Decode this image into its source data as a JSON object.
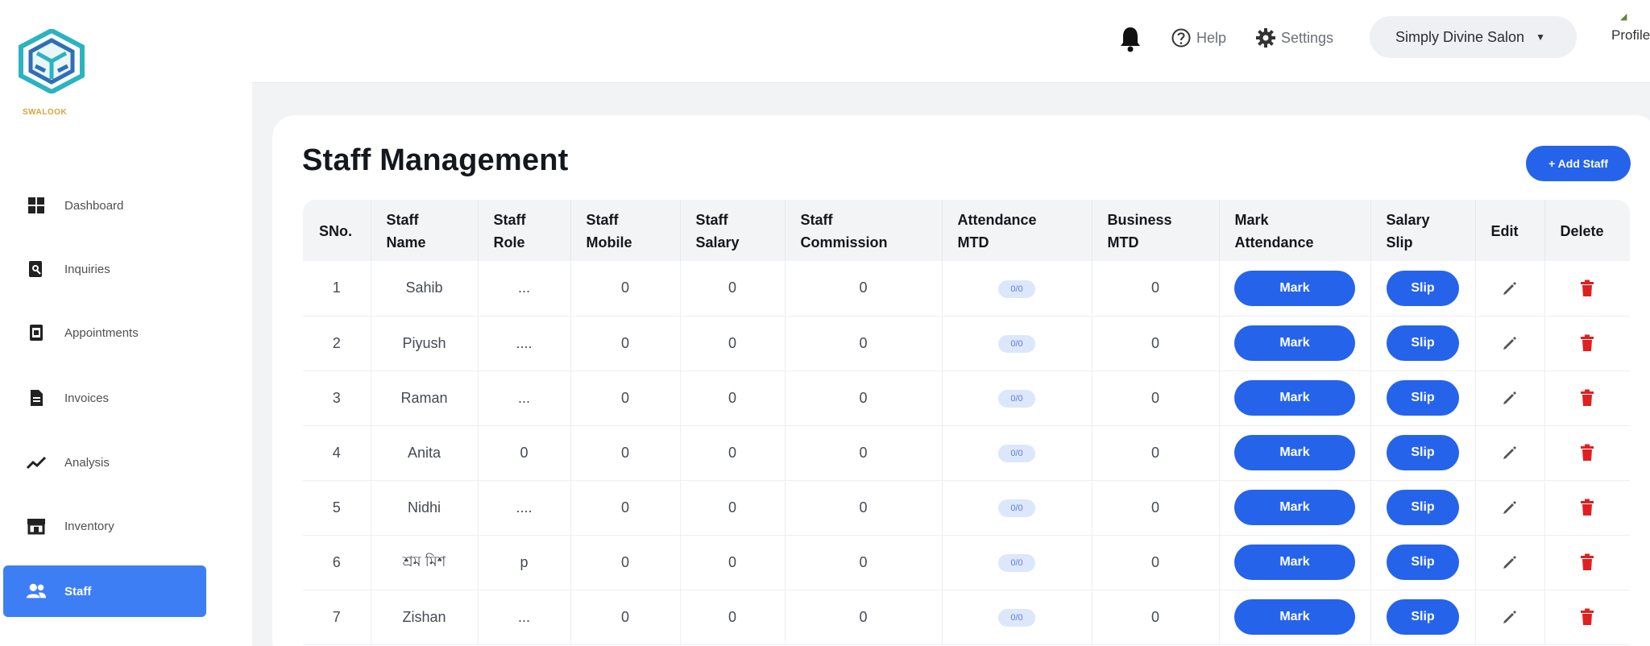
{
  "brand": {
    "name": "SWALOOK"
  },
  "sidebar": {
    "items": [
      {
        "label": "Dashboard",
        "icon": "dashboard-icon",
        "active": false
      },
      {
        "label": "Inquiries",
        "icon": "inquiries-icon",
        "active": false
      },
      {
        "label": "Appointments",
        "icon": "appointments-icon",
        "active": false
      },
      {
        "label": "Invoices",
        "icon": "invoices-icon",
        "active": false
      },
      {
        "label": "Analysis",
        "icon": "analysis-icon",
        "active": false
      },
      {
        "label": "Inventory",
        "icon": "inventory-icon",
        "active": false
      },
      {
        "label": "Staff",
        "icon": "staff-icon",
        "active": true
      }
    ]
  },
  "topbar": {
    "help_label": "Help",
    "settings_label": "Settings",
    "salon_label": "Simply Divine Salon",
    "profile_label": "Profile"
  },
  "page": {
    "title": "Staff Management",
    "add_button": "+ Add Staff"
  },
  "table": {
    "headers": [
      [
        "SNo.",
        ""
      ],
      [
        "Staff",
        "Name"
      ],
      [
        "Staff",
        "Role"
      ],
      [
        "Staff",
        "Mobile"
      ],
      [
        "Staff",
        "Salary"
      ],
      [
        "Staff",
        "Commission"
      ],
      [
        "Attendance",
        "MTD"
      ],
      [
        "Business",
        "MTD"
      ],
      [
        "Mark",
        "Attendance"
      ],
      [
        "Salary",
        "Slip"
      ],
      [
        "Edit",
        ""
      ],
      [
        "Delete",
        ""
      ]
    ],
    "mark_label": "Mark",
    "slip_label": "Slip",
    "rows": [
      {
        "sno": "1",
        "name": "Sahib",
        "role": "...",
        "mobile": "0",
        "salary": "0",
        "commission": "0",
        "attendance": "0/0",
        "business": "0"
      },
      {
        "sno": "2",
        "name": "Piyush",
        "role": "....",
        "mobile": "0",
        "salary": "0",
        "commission": "0",
        "attendance": "0/0",
        "business": "0"
      },
      {
        "sno": "3",
        "name": "Raman",
        "role": "...",
        "mobile": "0",
        "salary": "0",
        "commission": "0",
        "attendance": "0/0",
        "business": "0"
      },
      {
        "sno": "4",
        "name": "Anita",
        "role": "0",
        "mobile": "0",
        "salary": "0",
        "commission": "0",
        "attendance": "0/0",
        "business": "0"
      },
      {
        "sno": "5",
        "name": "Nidhi",
        "role": "....",
        "mobile": "0",
        "salary": "0",
        "commission": "0",
        "attendance": "0/0",
        "business": "0"
      },
      {
        "sno": "6",
        "name": "শ্রম মিশ",
        "role": "p",
        "mobile": "0",
        "salary": "0",
        "commission": "0",
        "attendance": "0/0",
        "business": "0"
      },
      {
        "sno": "7",
        "name": "Zishan",
        "role": "...",
        "mobile": "0",
        "salary": "0",
        "commission": "0",
        "attendance": "0/0",
        "business": "0"
      }
    ]
  },
  "colors": {
    "primary": "#2563eb",
    "sidebar_active": "#3d7ef5",
    "delete": "#e02020",
    "logo_teal": "#2bb3c0",
    "logo_blue": "#2f6fb6"
  }
}
